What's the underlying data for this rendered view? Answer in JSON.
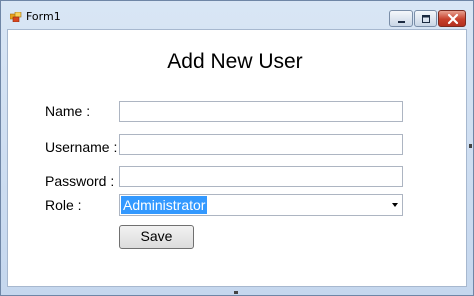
{
  "window": {
    "title": "Form1"
  },
  "form": {
    "heading": "Add New User",
    "name_label": "Name :",
    "name_value": "",
    "username_label": "Username :",
    "username_value": "",
    "password_label": "Password :",
    "password_value": "",
    "role_label": "Role :",
    "role_selected": "Administrator",
    "save_label": "Save"
  },
  "icons": {
    "app": "form-icon",
    "minimize": "minimize-icon",
    "maximize": "maximize-icon",
    "close": "close-icon",
    "dropdown": "chevron-down-icon"
  },
  "colors": {
    "selection": "#3399ff",
    "close_button": "#c7402c"
  }
}
